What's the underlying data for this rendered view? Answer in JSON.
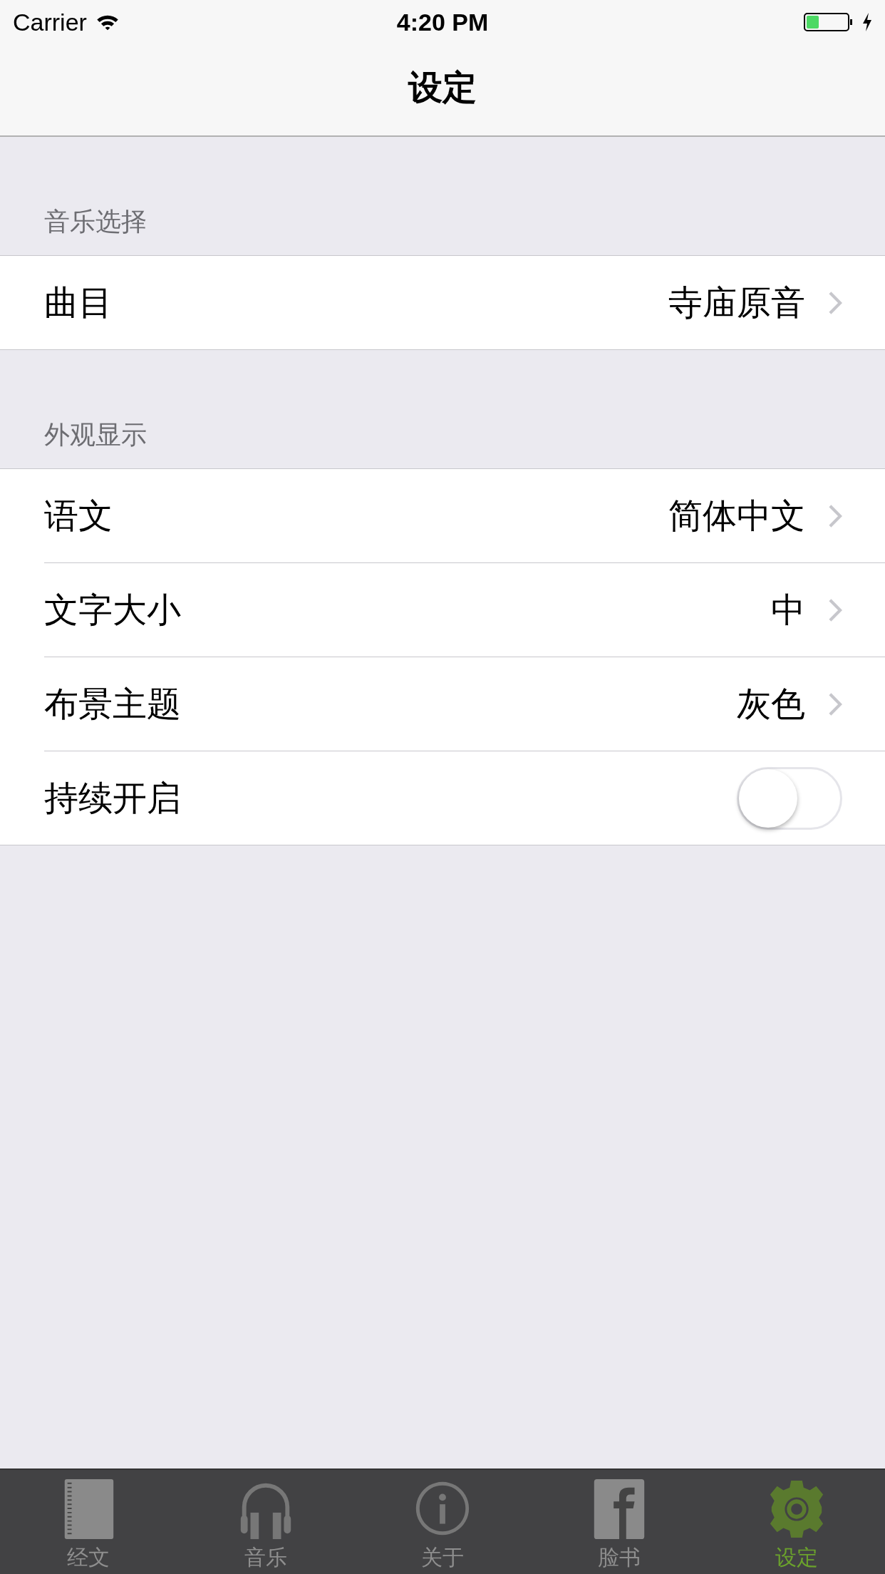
{
  "status_bar": {
    "carrier": "Carrier",
    "time": "4:20 PM"
  },
  "nav_bar": {
    "title": "设定"
  },
  "sections": [
    {
      "header": "音乐选择",
      "rows": [
        {
          "kind": "disclosure",
          "label": "曲目",
          "value": "寺庙原音"
        }
      ]
    },
    {
      "header": "外观显示",
      "rows": [
        {
          "kind": "disclosure",
          "label": "语文",
          "value": "简体中文"
        },
        {
          "kind": "disclosure",
          "label": "文字大小",
          "value": "中"
        },
        {
          "kind": "disclosure",
          "label": "布景主题",
          "value": "灰色"
        },
        {
          "kind": "toggle",
          "label": "持续开启",
          "on": false
        }
      ]
    }
  ],
  "tab_bar": [
    {
      "kind": "book",
      "label": "经文",
      "selected": false
    },
    {
      "kind": "headphones",
      "label": "音乐",
      "selected": false
    },
    {
      "kind": "info",
      "label": "关于",
      "selected": false
    },
    {
      "kind": "facebook",
      "label": "脸书",
      "selected": false
    },
    {
      "kind": "gear",
      "label": "设定",
      "selected": true
    }
  ]
}
